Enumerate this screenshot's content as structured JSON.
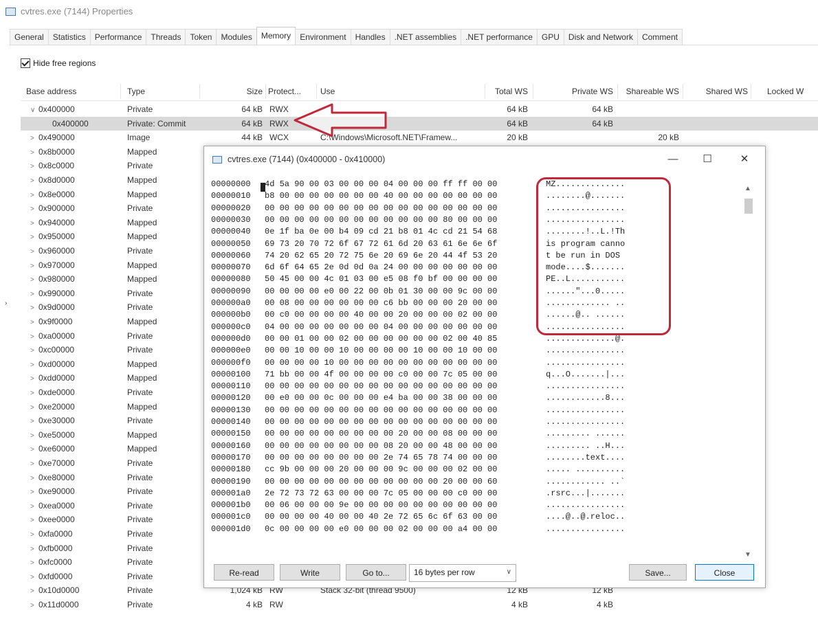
{
  "main_window": {
    "title": "cvtres.exe (7144) Properties",
    "tabs": [
      "General",
      "Statistics",
      "Performance",
      "Threads",
      "Token",
      "Modules",
      "Memory",
      "Environment",
      "Handles",
      ".NET assemblies",
      ".NET performance",
      "GPU",
      "Disk and Network",
      "Comment"
    ],
    "active_tab": "Memory",
    "hide_free_label": "Hide free regions",
    "hide_free_checked": true,
    "columns": [
      "Base address",
      "Type",
      "Size",
      "Protect...",
      "Use",
      "Total WS",
      "Private WS",
      "Shareable WS",
      "Shared WS",
      "Locked W"
    ],
    "rows": [
      {
        "chev": "∨",
        "base": "0x400000",
        "type": "Private",
        "size": "64 kB",
        "protect": "RWX",
        "use": "",
        "total": "64 kB",
        "private": "64 kB",
        "shareable": ""
      },
      {
        "chev": "",
        "base": "0x400000",
        "type": "Private: Commit",
        "size": "64 kB",
        "protect": "RWX",
        "use": "",
        "total": "64 kB",
        "private": "64 kB",
        "shareable": "",
        "selected": true,
        "indent": true
      },
      {
        "chev": ">",
        "base": "0x490000",
        "type": "Image",
        "size": "44 kB",
        "protect": "WCX",
        "use": "C:\\Windows\\Microsoft.NET\\Framew...",
        "total": "20 kB",
        "private": "",
        "shareable": "20 kB"
      },
      {
        "chev": ">",
        "base": "0x8b0000",
        "type": "Mapped"
      },
      {
        "chev": ">",
        "base": "0x8c0000",
        "type": "Private"
      },
      {
        "chev": ">",
        "base": "0x8d0000",
        "type": "Mapped"
      },
      {
        "chev": ">",
        "base": "0x8e0000",
        "type": "Mapped"
      },
      {
        "chev": ">",
        "base": "0x900000",
        "type": "Private"
      },
      {
        "chev": ">",
        "base": "0x940000",
        "type": "Mapped"
      },
      {
        "chev": ">",
        "base": "0x950000",
        "type": "Mapped"
      },
      {
        "chev": ">",
        "base": "0x960000",
        "type": "Private"
      },
      {
        "chev": ">",
        "base": "0x970000",
        "type": "Mapped"
      },
      {
        "chev": ">",
        "base": "0x980000",
        "type": "Mapped"
      },
      {
        "chev": ">",
        "base": "0x990000",
        "type": "Private"
      },
      {
        "chev": ">",
        "base": "0x9d0000",
        "type": "Private"
      },
      {
        "chev": ">",
        "base": "0x9f0000",
        "type": "Mapped"
      },
      {
        "chev": ">",
        "base": "0xa00000",
        "type": "Private"
      },
      {
        "chev": ">",
        "base": "0xc00000",
        "type": "Private"
      },
      {
        "chev": ">",
        "base": "0xd00000",
        "type": "Mapped"
      },
      {
        "chev": ">",
        "base": "0xdd0000",
        "type": "Mapped"
      },
      {
        "chev": ">",
        "base": "0xde0000",
        "type": "Private"
      },
      {
        "chev": ">",
        "base": "0xe20000",
        "type": "Mapped"
      },
      {
        "chev": ">",
        "base": "0xe30000",
        "type": "Private"
      },
      {
        "chev": ">",
        "base": "0xe50000",
        "type": "Mapped"
      },
      {
        "chev": ">",
        "base": "0xe60000",
        "type": "Mapped"
      },
      {
        "chev": ">",
        "base": "0xe70000",
        "type": "Private"
      },
      {
        "chev": ">",
        "base": "0xe80000",
        "type": "Private"
      },
      {
        "chev": ">",
        "base": "0xe90000",
        "type": "Private"
      },
      {
        "chev": ">",
        "base": "0xea0000",
        "type": "Private"
      },
      {
        "chev": ">",
        "base": "0xee0000",
        "type": "Private"
      },
      {
        "chev": ">",
        "base": "0xfa0000",
        "type": "Private"
      },
      {
        "chev": ">",
        "base": "0xfb0000",
        "type": "Private"
      },
      {
        "chev": ">",
        "base": "0xfc0000",
        "type": "Private"
      },
      {
        "chev": ">",
        "base": "0xfd0000",
        "type": "Private"
      },
      {
        "chev": ">",
        "base": "0x10d0000",
        "type": "Private",
        "size": "1,024 kB",
        "protect": "RW",
        "use": "Stack 32-bit (thread 9500)",
        "total": "12 kB",
        "private": "12 kB",
        "shareable": ""
      },
      {
        "chev": ">",
        "base": "0x11d0000",
        "type": "Private",
        "size": "4 kB",
        "protect": "RW",
        "use": "",
        "total": "4 kB",
        "private": "4 kB",
        "shareable": ""
      }
    ]
  },
  "hex_window": {
    "title": "cvtres.exe (7144) (0x400000 - 0x410000)",
    "minimize": "—",
    "maximize": "☐",
    "close": "✕",
    "lines": [
      {
        "off": "00000000",
        "hex": "4d 5a 90 00 03 00 00 00 04 00 00 00 ff ff 00 00",
        "asc": "MZ.............."
      },
      {
        "off": "00000010",
        "hex": "b8 00 00 00 00 00 00 00 40 00 00 00 00 00 00 00",
        "asc": "........@......."
      },
      {
        "off": "00000020",
        "hex": "00 00 00 00 00 00 00 00 00 00 00 00 00 00 00 00",
        "asc": "................"
      },
      {
        "off": "00000030",
        "hex": "00 00 00 00 00 00 00 00 00 00 00 00 80 00 00 00",
        "asc": "................"
      },
      {
        "off": "00000040",
        "hex": "0e 1f ba 0e 00 b4 09 cd 21 b8 01 4c cd 21 54 68",
        "asc": "........!..L.!Th"
      },
      {
        "off": "00000050",
        "hex": "69 73 20 70 72 6f 67 72 61 6d 20 63 61 6e 6e 6f",
        "asc": "is program canno"
      },
      {
        "off": "00000060",
        "hex": "74 20 62 65 20 72 75 6e 20 69 6e 20 44 4f 53 20",
        "asc": "t be run in DOS "
      },
      {
        "off": "00000070",
        "hex": "6d 6f 64 65 2e 0d 0d 0a 24 00 00 00 00 00 00 00",
        "asc": "mode....$......."
      },
      {
        "off": "00000080",
        "hex": "50 45 00 00 4c 01 03 00 e5 08 f0 bf 00 00 00 00",
        "asc": "PE..L..........."
      },
      {
        "off": "00000090",
        "hex": "00 00 00 00 e0 00 22 00 0b 01 30 00 00 9c 00 00",
        "asc": "......\"...0....."
      },
      {
        "off": "000000a0",
        "hex": "00 08 00 00 00 00 00 00 c6 bb 00 00 00 20 00 00",
        "asc": "............. .."
      },
      {
        "off": "000000b0",
        "hex": "00 c0 00 00 00 00 40 00 00 20 00 00 00 02 00 00",
        "asc": "......@.. ......"
      },
      {
        "off": "000000c0",
        "hex": "04 00 00 00 00 00 00 00 04 00 00 00 00 00 00 00",
        "asc": "................"
      },
      {
        "off": "000000d0",
        "hex": "00 00 01 00 00 02 00 00 00 00 00 00 02 00 40 85",
        "asc": "..............@."
      },
      {
        "off": "000000e0",
        "hex": "00 00 10 00 00 10 00 00 00 00 10 00 00 10 00 00",
        "asc": "................"
      },
      {
        "off": "000000f0",
        "hex": "00 00 00 00 10 00 00 00 00 00 00 00 00 00 00 00",
        "asc": "................"
      },
      {
        "off": "00000100",
        "hex": "71 bb 00 00 4f 00 00 00 00 c0 00 00 7c 05 00 00",
        "asc": "q...O.......|..."
      },
      {
        "off": "00000110",
        "hex": "00 00 00 00 00 00 00 00 00 00 00 00 00 00 00 00",
        "asc": "................"
      },
      {
        "off": "00000120",
        "hex": "00 e0 00 00 0c 00 00 00 e4 ba 00 00 38 00 00 00",
        "asc": "............8..."
      },
      {
        "off": "00000130",
        "hex": "00 00 00 00 00 00 00 00 00 00 00 00 00 00 00 00",
        "asc": "................"
      },
      {
        "off": "00000140",
        "hex": "00 00 00 00 00 00 00 00 00 00 00 00 00 00 00 00",
        "asc": "................"
      },
      {
        "off": "00000150",
        "hex": "00 00 00 00 00 00 00 00 00 20 00 00 08 00 00 00",
        "asc": "......... ......"
      },
      {
        "off": "00000160",
        "hex": "00 00 00 00 00 00 00 00 08 20 00 00 48 00 00 00",
        "asc": "......... ..H..."
      },
      {
        "off": "00000170",
        "hex": "00 00 00 00 00 00 00 00 2e 74 65 78 74 00 00 00",
        "asc": "........text...."
      },
      {
        "off": "00000180",
        "hex": "cc 9b 00 00 00 20 00 00 00 9c 00 00 00 02 00 00",
        "asc": "..... .........."
      },
      {
        "off": "00000190",
        "hex": "00 00 00 00 00 00 00 00 00 00 00 00 20 00 00 60",
        "asc": "............ ..`"
      },
      {
        "off": "000001a0",
        "hex": "2e 72 73 72 63 00 00 00 7c 05 00 00 00 c0 00 00",
        "asc": ".rsrc...|......."
      },
      {
        "off": "000001b0",
        "hex": "00 06 00 00 00 9e 00 00 00 00 00 00 00 00 00 00",
        "asc": "................"
      },
      {
        "off": "000001c0",
        "hex": "00 00 00 00 40 00 00 40 2e 72 65 6c 6f 63 00 00",
        "asc": "....@..@.reloc.."
      },
      {
        "off": "000001d0",
        "hex": "0c 00 00 00 00 e0 00 00 00 02 00 00 00 a4 00 00",
        "asc": "................"
      }
    ],
    "buttons": {
      "reread": "Re-read",
      "write": "Write",
      "goto": "Go to...",
      "save": "Save...",
      "close": "Close"
    },
    "bytes_per_row": "16 bytes per row"
  },
  "colors": {
    "highlight": "#c0293a",
    "selected_row": "#d9d9d9",
    "accent": "#0078d7"
  },
  "icons": [
    "window-icon",
    "expand-chevron-icon",
    "checkbox-check-icon",
    "red-arrow-annotation",
    "scroll-up-icon",
    "scroll-down-icon",
    "dropdown-arrow-icon"
  ]
}
